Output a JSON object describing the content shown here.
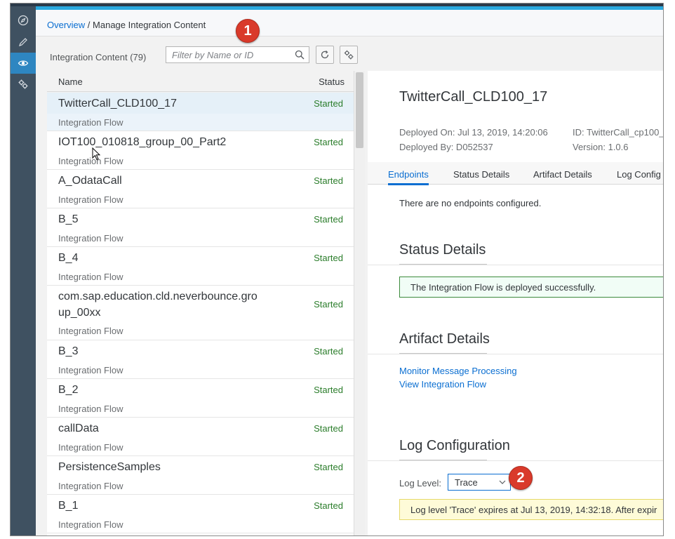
{
  "breadcrumb": {
    "link": "Overview",
    "separator": " / ",
    "current": "Manage Integration Content"
  },
  "callouts": {
    "one": "1",
    "two": "2"
  },
  "sidebar": {
    "items": [
      {
        "icon": "compass-icon",
        "active": false
      },
      {
        "icon": "pencil-icon",
        "active": false
      },
      {
        "icon": "eye-icon",
        "active": true
      },
      {
        "icon": "gears-icon",
        "active": false
      }
    ]
  },
  "toolbar": {
    "count_label": "Integration Content (79)",
    "search_placeholder": "Filter by Name or ID",
    "refresh_icon": "refresh-icon",
    "settings_icon": "settings-icon"
  },
  "list": {
    "header_name": "Name",
    "header_status": "Status",
    "items": [
      {
        "name": "TwitterCall_CLD100_17",
        "type": "Integration Flow",
        "status": "Started"
      },
      {
        "name": "IOT100_010818_group_00_Part2",
        "type": "Integration Flow",
        "status": "Started"
      },
      {
        "name": "A_OdataCall",
        "type": "Integration Flow",
        "status": "Started"
      },
      {
        "name": "B_5",
        "type": "Integration Flow",
        "status": "Started"
      },
      {
        "name": "B_4",
        "type": "Integration Flow",
        "status": "Started"
      },
      {
        "name_line1": "com.sap.education.cld.neverbounce.gro",
        "name_line2": "up_00xx",
        "type": "Integration Flow",
        "status": "Started"
      },
      {
        "name": "B_3",
        "type": "Integration Flow",
        "status": "Started"
      },
      {
        "name": "B_2",
        "type": "Integration Flow",
        "status": "Started"
      },
      {
        "name": "callData",
        "type": "Integration Flow",
        "status": "Started"
      },
      {
        "name": "PersistenceSamples",
        "type": "Integration Flow",
        "status": "Started"
      },
      {
        "name": "B_1",
        "type": "Integration Flow",
        "status": "Started"
      }
    ]
  },
  "detail": {
    "title": "TwitterCall_CLD100_17",
    "deployed_on": "Deployed On: Jul 13, 2019, 14:20:06",
    "deployed_by": "Deployed By: D052537",
    "id": "ID: TwitterCall_cp100_",
    "version": "Version: 1.0.6",
    "tabs": [
      "Endpoints",
      "Status Details",
      "Artifact Details",
      "Log Config"
    ],
    "no_endpoints": "There are no endpoints configured.",
    "status_title": "Status Details",
    "status_message": "The Integration Flow is deployed successfully.",
    "artifact_title": "Artifact Details",
    "links": [
      "Monitor Message Processing",
      "View Integration Flow"
    ],
    "log_title": "Log Configuration",
    "log_level_label": "Log Level:",
    "log_level_value": "Trace",
    "log_warning": "Log level 'Trace' expires at Jul 13, 2019, 14:32:18. After expir"
  },
  "colors": {
    "accent": "#0a6ed1",
    "success": "#2b7d2b",
    "callout": "#d93a2b",
    "sidebar": "#3f5161"
  }
}
